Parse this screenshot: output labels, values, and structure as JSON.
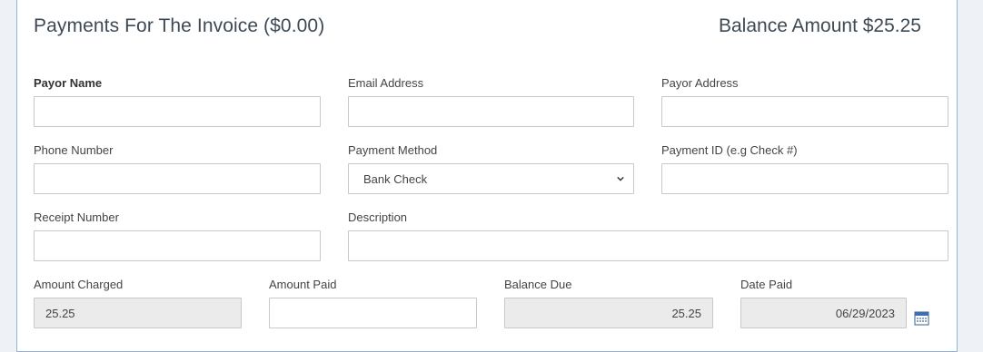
{
  "header": {
    "title": "Payments For The Invoice ($0.00)",
    "balance": "Balance Amount $25.25"
  },
  "fields": {
    "payor_name": {
      "label": "Payor Name",
      "value": ""
    },
    "email": {
      "label": "Email Address",
      "value": ""
    },
    "payor_address": {
      "label": "Payor Address",
      "value": ""
    },
    "phone": {
      "label": "Phone Number",
      "value": ""
    },
    "payment_method": {
      "label": "Payment Method",
      "value": "Bank Check"
    },
    "payment_id": {
      "label": "Payment ID (e.g Check #)",
      "value": ""
    },
    "receipt": {
      "label": "Receipt Number",
      "value": ""
    },
    "description": {
      "label": "Description",
      "value": ""
    },
    "amount_charged": {
      "label": "Amount Charged",
      "value": "25.25"
    },
    "amount_paid": {
      "label": "Amount Paid",
      "value": ""
    },
    "balance_due": {
      "label": "Balance Due",
      "value": "25.25"
    },
    "date_paid": {
      "label": "Date Paid",
      "value": "06/29/2023"
    }
  },
  "icons": {
    "select_arrow": "chevron-down-icon",
    "date_picker": "calendar-icon"
  },
  "colors": {
    "panel_border": "#8fb3d9",
    "readonly_bg": "#ebebeb",
    "input_border": "#c8c8c8"
  }
}
